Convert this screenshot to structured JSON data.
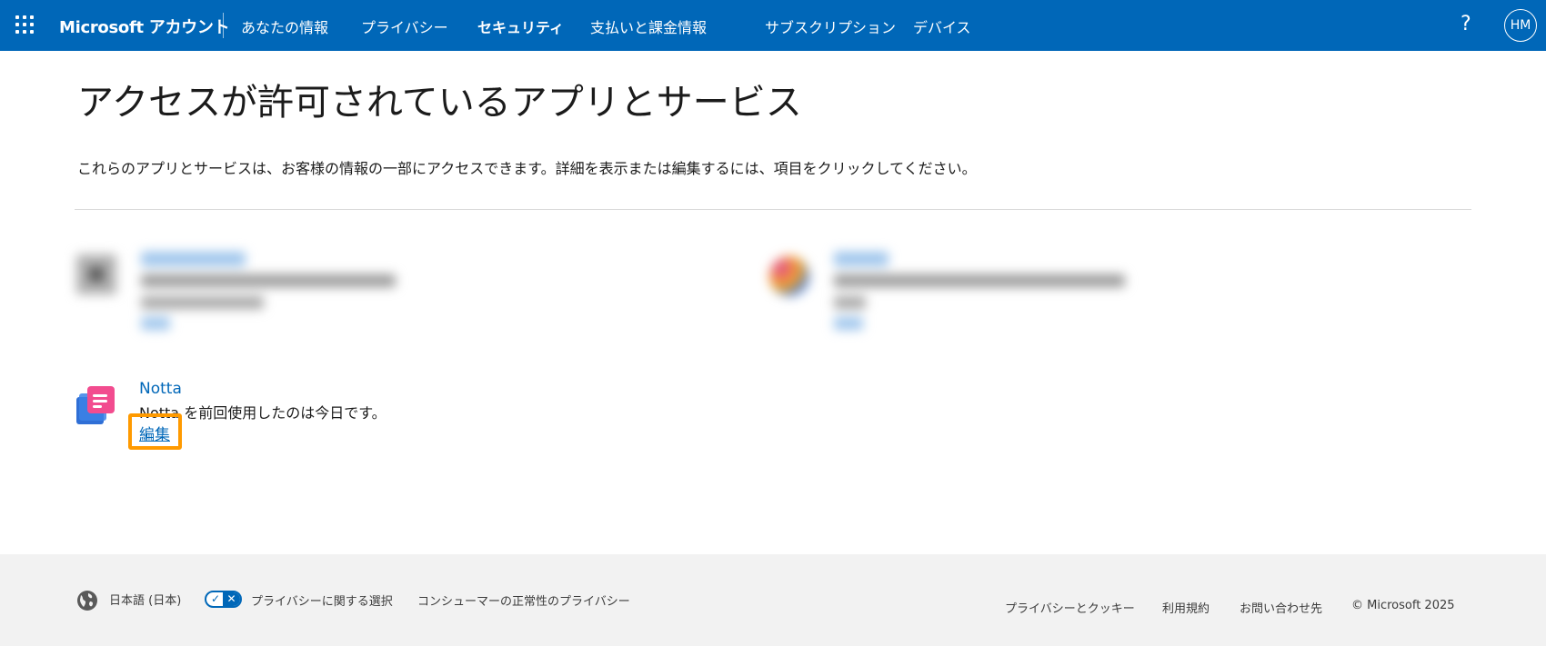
{
  "header": {
    "brand": "Microsoft アカウント",
    "nav": [
      {
        "label": "あなたの情報"
      },
      {
        "label": "プライバシー"
      },
      {
        "label": "セキュリティ"
      },
      {
        "label": "支払いと課金情報"
      },
      {
        "label": "サブスクリプション"
      },
      {
        "label": "デバイス"
      }
    ],
    "active_nav": "セキュリティ",
    "help_label": "?",
    "avatar_initials": "HM"
  },
  "main": {
    "title": "アクセスが許可されているアプリとサービス",
    "description": "これらのアプリとサービスは、お客様の情報の一部にアクセスできます。詳細を表示または編集するには、項目をクリックしてください。",
    "apps": [
      {
        "name": "Notta",
        "last_used": "Notta を前回使用したのは今日です。",
        "edit_label": "編集",
        "icon": "notta-icon"
      }
    ]
  },
  "footer": {
    "language": "日本語 (日本)",
    "privacy_choices": "プライバシーに関する選択",
    "consumer_health_privacy": "コンシューマーの正常性のプライバシー",
    "privacy_cookies": "プライバシーとクッキー",
    "terms": "利用規約",
    "contact": "お問い合わせ先",
    "copyright": "© Microsoft 2025"
  },
  "colors": {
    "brand_blue": "#0067b8",
    "highlight": "#ff9a00",
    "footer_bg": "#f2f2f2"
  }
}
